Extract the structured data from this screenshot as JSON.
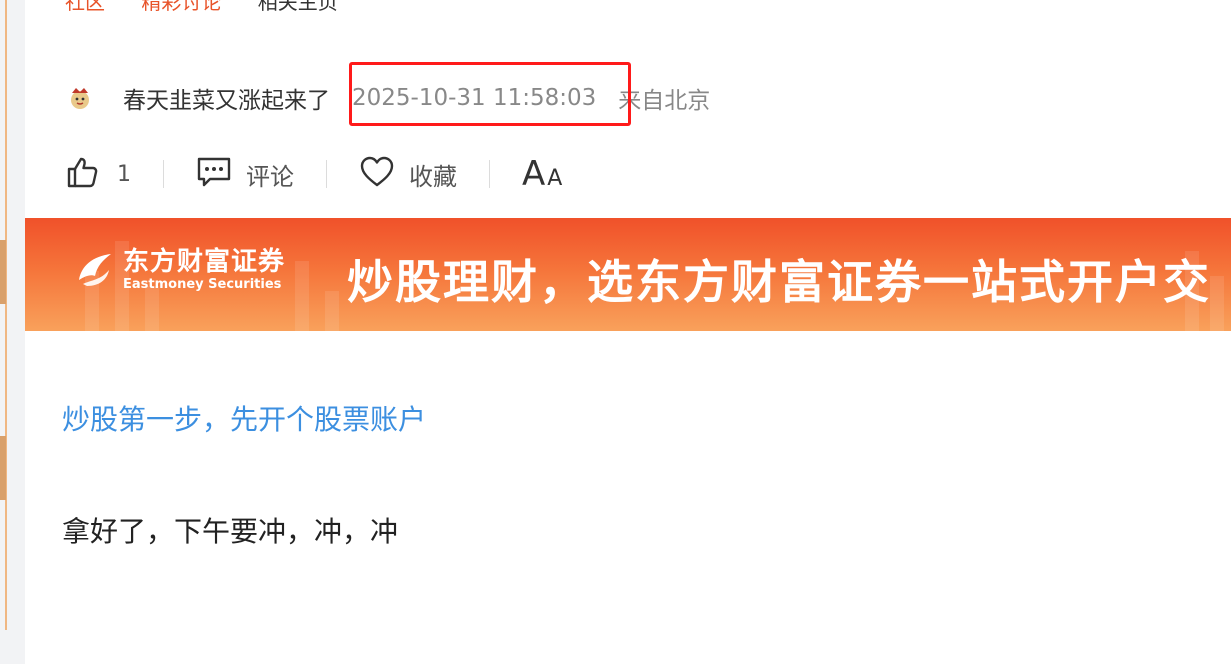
{
  "header_fragments": [
    "社区",
    "精彩讨论",
    "相关主页"
  ],
  "post": {
    "author": "春天韭菜又涨起来了",
    "timestamp": "2025-10-31 11:58:03",
    "location": "来自北京",
    "body": "拿好了，下午要冲，冲，冲"
  },
  "actions": {
    "like_count": "1",
    "comment_label": "评论",
    "favorite_label": "收藏",
    "font_big": "A",
    "font_small": "A"
  },
  "banner": {
    "brand_cn": "东方财富证券",
    "brand_en": "Eastmoney Securities",
    "slogan": "炒股理财，选东方财富证券一站式开户交"
  },
  "promo_link": "炒股第一步，先开个股票账户",
  "icons": [
    "avatar-icon",
    "thumbs-up-icon",
    "comment-icon",
    "heart-icon",
    "eastmoney-logo-icon"
  ],
  "colors": {
    "highlight_border": "#ff1a1a",
    "link_blue": "#3c8fe0",
    "banner_orange": "#f0512a"
  }
}
